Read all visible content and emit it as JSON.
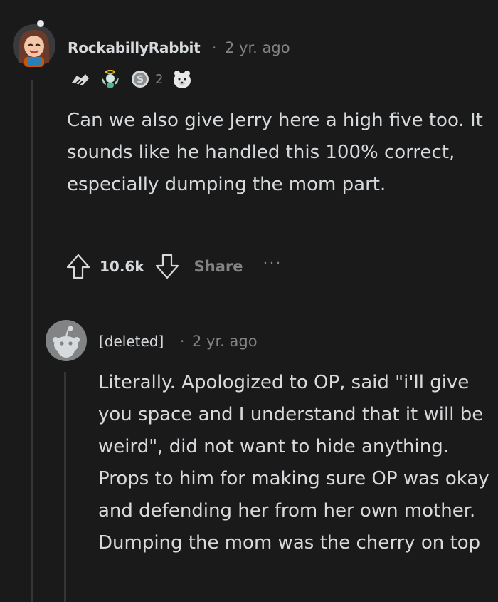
{
  "comment": {
    "username": "RockabillyRabbit",
    "separator": "·",
    "time": "2 yr. ago",
    "award_count": "2",
    "awards": [
      "handshake-award-icon",
      "angel-award-icon",
      "silver-coin-award-icon",
      "bear-award-icon"
    ],
    "body": "Can we also give Jerry here a high five too. It sounds like he handled this 100% correct, especially dumping the mom part.",
    "score": "10.6k",
    "share_label": "Share",
    "more_label": "···"
  },
  "reply": {
    "username": "[deleted]",
    "separator": "·",
    "time": "2 yr. ago",
    "body": "Literally. Apologized to OP, said \"i'll give you space and I understand that it will be weird\", did not want to hide anything. Props to him for making sure OP was okay and defending her from her own mother. Dumping the mom was the cherry on top"
  }
}
